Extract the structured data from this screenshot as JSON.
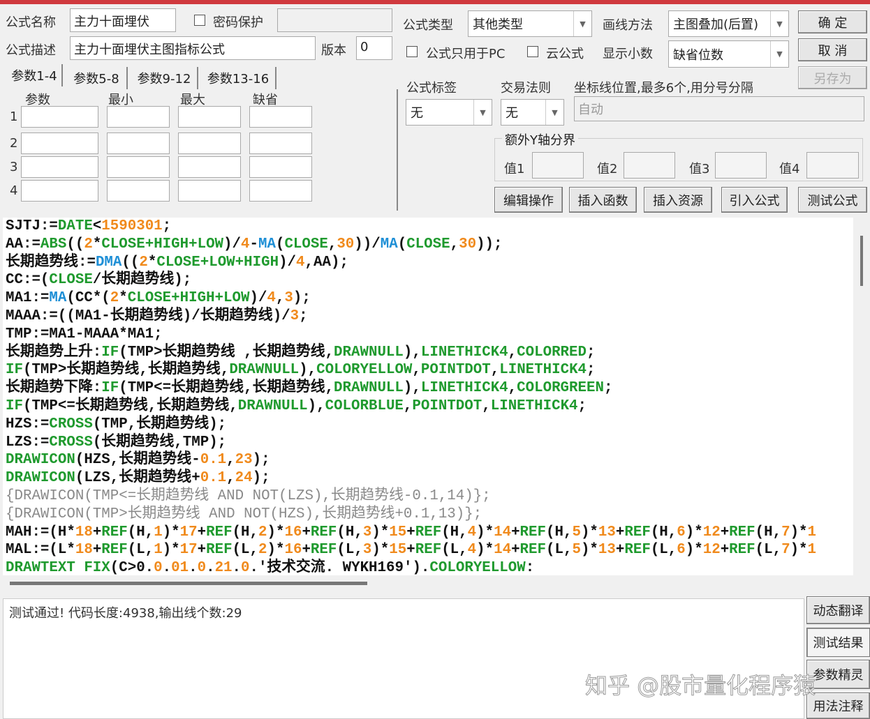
{
  "form": {
    "name_label": "公式名称",
    "name_value": "主力十面埋伏",
    "password_label": "密码保护",
    "password_value": "",
    "desc_label": "公式描述",
    "desc_value": "主力十面埋伏主图指标公式",
    "version_label": "版本",
    "version_value": "0",
    "type_label": "公式类型",
    "type_value": "其他类型",
    "draw_label": "画线方法",
    "draw_value": "主图叠加(后置)",
    "pc_only_label": "公式只用于PC",
    "cloud_label": "云公式",
    "decimal_label": "显示小数",
    "decimal_value": "缺省位数",
    "tag_label": "公式标签",
    "tag_value": "无",
    "rule_label": "交易法则",
    "rule_value": "无",
    "axis_label": "坐标线位置,最多6个,用分号分隔",
    "axis_value": "自动",
    "yaxis_group": "额外Y轴分界",
    "yaxis_values": [
      "值1",
      "值2",
      "值3",
      "值4"
    ]
  },
  "buttons": {
    "ok": "确 定",
    "cancel": "取 消",
    "save_as": "另存为",
    "edit": "编辑操作",
    "insert_func": "插入函数",
    "insert_res": "插入资源",
    "import": "引入公式",
    "test": "测试公式",
    "translate": "动态翻译",
    "result": "测试结果",
    "wizard": "参数精灵",
    "usage": "用法注释"
  },
  "params": {
    "tabs": [
      "参数1-4",
      "参数5-8",
      "参数9-12",
      "参数13-16"
    ],
    "headers": [
      "参数",
      "最小",
      "最大",
      "缺省"
    ],
    "rows": [
      "1",
      "2",
      "3",
      "4"
    ]
  },
  "code_lines": [
    [
      [
        "k",
        "SJTJ:="
      ],
      [
        "g",
        "DATE"
      ],
      [
        "k",
        "<"
      ],
      [
        "o",
        "1590301"
      ],
      [
        "k",
        ";"
      ]
    ],
    [
      [
        "k",
        "AA:="
      ],
      [
        "g",
        "ABS"
      ],
      [
        "k",
        "(("
      ],
      [
        "o",
        "2"
      ],
      [
        "k",
        "*"
      ],
      [
        "g",
        "CLOSE+HIGH+LOW"
      ],
      [
        "k",
        ")/"
      ],
      [
        "o",
        "4"
      ],
      [
        "k",
        "-"
      ],
      [
        "b",
        "MA"
      ],
      [
        "k",
        "("
      ],
      [
        "g",
        "CLOSE"
      ],
      [
        "k",
        ","
      ],
      [
        "o",
        "30"
      ],
      [
        "k",
        "))/"
      ],
      [
        "b",
        "MA"
      ],
      [
        "k",
        "("
      ],
      [
        "g",
        "CLOSE"
      ],
      [
        "k",
        ","
      ],
      [
        "o",
        "30"
      ],
      [
        "k",
        "));"
      ]
    ],
    [
      [
        "k",
        "长期趋势线:="
      ],
      [
        "b",
        "DMA"
      ],
      [
        "k",
        "(("
      ],
      [
        "o",
        "2"
      ],
      [
        "k",
        "*"
      ],
      [
        "g",
        "CLOSE+LOW+HIGH"
      ],
      [
        "k",
        ")/"
      ],
      [
        "o",
        "4"
      ],
      [
        "k",
        ",AA);"
      ]
    ],
    [
      [
        "k",
        "CC:=("
      ],
      [
        "g",
        "CLOSE"
      ],
      [
        "k",
        "/长期趋势线);"
      ]
    ],
    [
      [
        "k",
        "MA1:="
      ],
      [
        "b",
        "MA"
      ],
      [
        "k",
        "(CC*("
      ],
      [
        "o",
        "2"
      ],
      [
        "k",
        "*"
      ],
      [
        "g",
        "CLOSE+HIGH+LOW"
      ],
      [
        "k",
        ")/"
      ],
      [
        "o",
        "4"
      ],
      [
        "k",
        ","
      ],
      [
        "o",
        "3"
      ],
      [
        "k",
        ");"
      ]
    ],
    [
      [
        "k",
        "MAAA:=((MA1-长期趋势线)/长期趋势线)/"
      ],
      [
        "o",
        "3"
      ],
      [
        "k",
        ";"
      ]
    ],
    [
      [
        "k",
        "TMP:=MA1-MAAA*MA1;"
      ]
    ],
    [
      [
        "k",
        "长期趋势上升:"
      ],
      [
        "g",
        "IF"
      ],
      [
        "k",
        "(TMP>长期趋势线 ,长期趋势线,"
      ],
      [
        "g",
        "DRAWNULL"
      ],
      [
        "k",
        "),"
      ],
      [
        "g",
        "LINETHICK4"
      ],
      [
        "k",
        ","
      ],
      [
        "g",
        "COLORRED"
      ],
      [
        "k",
        ";"
      ]
    ],
    [
      [
        "g",
        "IF"
      ],
      [
        "k",
        "(TMP>长期趋势线,长期趋势线,"
      ],
      [
        "g",
        "DRAWNULL"
      ],
      [
        "k",
        "),"
      ],
      [
        "g",
        "COLORYELLOW"
      ],
      [
        "k",
        ","
      ],
      [
        "g",
        "POINTDOT"
      ],
      [
        "k",
        ","
      ],
      [
        "g",
        "LINETHICK4"
      ],
      [
        "k",
        ";"
      ]
    ],
    [
      [
        "k",
        "长期趋势下降:"
      ],
      [
        "g",
        "IF"
      ],
      [
        "k",
        "(TMP<=长期趋势线,长期趋势线,"
      ],
      [
        "g",
        "DRAWNULL"
      ],
      [
        "k",
        "),"
      ],
      [
        "g",
        "LINETHICK4"
      ],
      [
        "k",
        ","
      ],
      [
        "g",
        "COLORGREEN"
      ],
      [
        "k",
        ";"
      ]
    ],
    [
      [
        "g",
        "IF"
      ],
      [
        "k",
        "(TMP<=长期趋势线,长期趋势线,"
      ],
      [
        "g",
        "DRAWNULL"
      ],
      [
        "k",
        "),"
      ],
      [
        "g",
        "COLORBLUE"
      ],
      [
        "k",
        ","
      ],
      [
        "g",
        "POINTDOT"
      ],
      [
        "k",
        ","
      ],
      [
        "g",
        "LINETHICK4"
      ],
      [
        "k",
        ";"
      ]
    ],
    [
      [
        "k",
        "HZS:="
      ],
      [
        "g",
        "CROSS"
      ],
      [
        "k",
        "(TMP,长期趋势线);"
      ]
    ],
    [
      [
        "k",
        "LZS:="
      ],
      [
        "g",
        "CROSS"
      ],
      [
        "k",
        "(长期趋势线,TMP);"
      ]
    ],
    [
      [
        "g",
        "DRAWICON"
      ],
      [
        "k",
        "(HZS,长期趋势线-"
      ],
      [
        "o",
        "0.1"
      ],
      [
        "k",
        ","
      ],
      [
        "o",
        "23"
      ],
      [
        "k",
        ");"
      ]
    ],
    [
      [
        "g",
        "DRAWICON"
      ],
      [
        "k",
        "(LZS,长期趋势线+"
      ],
      [
        "o",
        "0.1"
      ],
      [
        "k",
        ","
      ],
      [
        "o",
        "24"
      ],
      [
        "k",
        ");"
      ]
    ],
    [
      [
        "c",
        "{DRAWICON(TMP<=长期趋势线 AND NOT(LZS),长期趋势线-0.1,14)};"
      ]
    ],
    [
      [
        "c",
        "{DRAWICON(TMP>长期趋势线 AND NOT(HZS),长期趋势线+0.1,13)};"
      ]
    ],
    [
      [
        "k",
        "MAH:=(H*"
      ],
      [
        "o",
        "18"
      ],
      [
        "k",
        "+"
      ],
      [
        "g",
        "REF"
      ],
      [
        "k",
        "(H,"
      ],
      [
        "o",
        "1"
      ],
      [
        "k",
        ")*"
      ],
      [
        "o",
        "17"
      ],
      [
        "k",
        "+"
      ],
      [
        "g",
        "REF"
      ],
      [
        "k",
        "(H,"
      ],
      [
        "o",
        "2"
      ],
      [
        "k",
        ")*"
      ],
      [
        "o",
        "16"
      ],
      [
        "k",
        "+"
      ],
      [
        "g",
        "REF"
      ],
      [
        "k",
        "(H,"
      ],
      [
        "o",
        "3"
      ],
      [
        "k",
        ")*"
      ],
      [
        "o",
        "15"
      ],
      [
        "k",
        "+"
      ],
      [
        "g",
        "REF"
      ],
      [
        "k",
        "(H,"
      ],
      [
        "o",
        "4"
      ],
      [
        "k",
        ")*"
      ],
      [
        "o",
        "14"
      ],
      [
        "k",
        "+"
      ],
      [
        "g",
        "REF"
      ],
      [
        "k",
        "(H,"
      ],
      [
        "o",
        "5"
      ],
      [
        "k",
        ")*"
      ],
      [
        "o",
        "13"
      ],
      [
        "k",
        "+"
      ],
      [
        "g",
        "REF"
      ],
      [
        "k",
        "(H,"
      ],
      [
        "o",
        "6"
      ],
      [
        "k",
        ")*"
      ],
      [
        "o",
        "12"
      ],
      [
        "k",
        "+"
      ],
      [
        "g",
        "REF"
      ],
      [
        "k",
        "(H,"
      ],
      [
        "o",
        "7"
      ],
      [
        "k",
        ")*"
      ],
      [
        "o",
        "1"
      ]
    ],
    [
      [
        "k",
        "MAL:=(L*"
      ],
      [
        "o",
        "18"
      ],
      [
        "k",
        "+"
      ],
      [
        "g",
        "REF"
      ],
      [
        "k",
        "(L,"
      ],
      [
        "o",
        "1"
      ],
      [
        "k",
        ")*"
      ],
      [
        "o",
        "17"
      ],
      [
        "k",
        "+"
      ],
      [
        "g",
        "REF"
      ],
      [
        "k",
        "(L,"
      ],
      [
        "o",
        "2"
      ],
      [
        "k",
        ")*"
      ],
      [
        "o",
        "16"
      ],
      [
        "k",
        "+"
      ],
      [
        "g",
        "REF"
      ],
      [
        "k",
        "(L,"
      ],
      [
        "o",
        "3"
      ],
      [
        "k",
        ")*"
      ],
      [
        "o",
        "15"
      ],
      [
        "k",
        "+"
      ],
      [
        "g",
        "REF"
      ],
      [
        "k",
        "(L,"
      ],
      [
        "o",
        "4"
      ],
      [
        "k",
        ")*"
      ],
      [
        "o",
        "14"
      ],
      [
        "k",
        "+"
      ],
      [
        "g",
        "REF"
      ],
      [
        "k",
        "(L,"
      ],
      [
        "o",
        "5"
      ],
      [
        "k",
        ")*"
      ],
      [
        "o",
        "13"
      ],
      [
        "k",
        "+"
      ],
      [
        "g",
        "REF"
      ],
      [
        "k",
        "(L,"
      ],
      [
        "o",
        "6"
      ],
      [
        "k",
        ")*"
      ],
      [
        "o",
        "12"
      ],
      [
        "k",
        "+"
      ],
      [
        "g",
        "REF"
      ],
      [
        "k",
        "(L,"
      ],
      [
        "o",
        "7"
      ],
      [
        "k",
        ")*"
      ],
      [
        "o",
        "1"
      ]
    ],
    [
      [
        "g",
        "DRAWTEXT FIX"
      ],
      [
        "k",
        "(C>0."
      ],
      [
        "o",
        "0"
      ],
      [
        "k",
        "."
      ],
      [
        "o",
        "01"
      ],
      [
        "k",
        "."
      ],
      [
        "o",
        "0"
      ],
      [
        "k",
        "."
      ],
      [
        "o",
        "21"
      ],
      [
        "k",
        "."
      ],
      [
        "o",
        "0"
      ],
      [
        "k",
        ".'技术交流. WYKH169')."
      ],
      [
        "g",
        "COLORYELLOW"
      ],
      [
        "k",
        ":"
      ]
    ]
  ],
  "output": "测试通过! 代码长度:4938,输出线个数:29",
  "watermark": "知乎 @股市量化程序猿",
  "colors": {
    "title_bar": "#d0393e",
    "keyword": "#1f9a2e",
    "number": "#f08a1c",
    "function": "#1e8fd6",
    "comment": "#8a8a8a"
  }
}
